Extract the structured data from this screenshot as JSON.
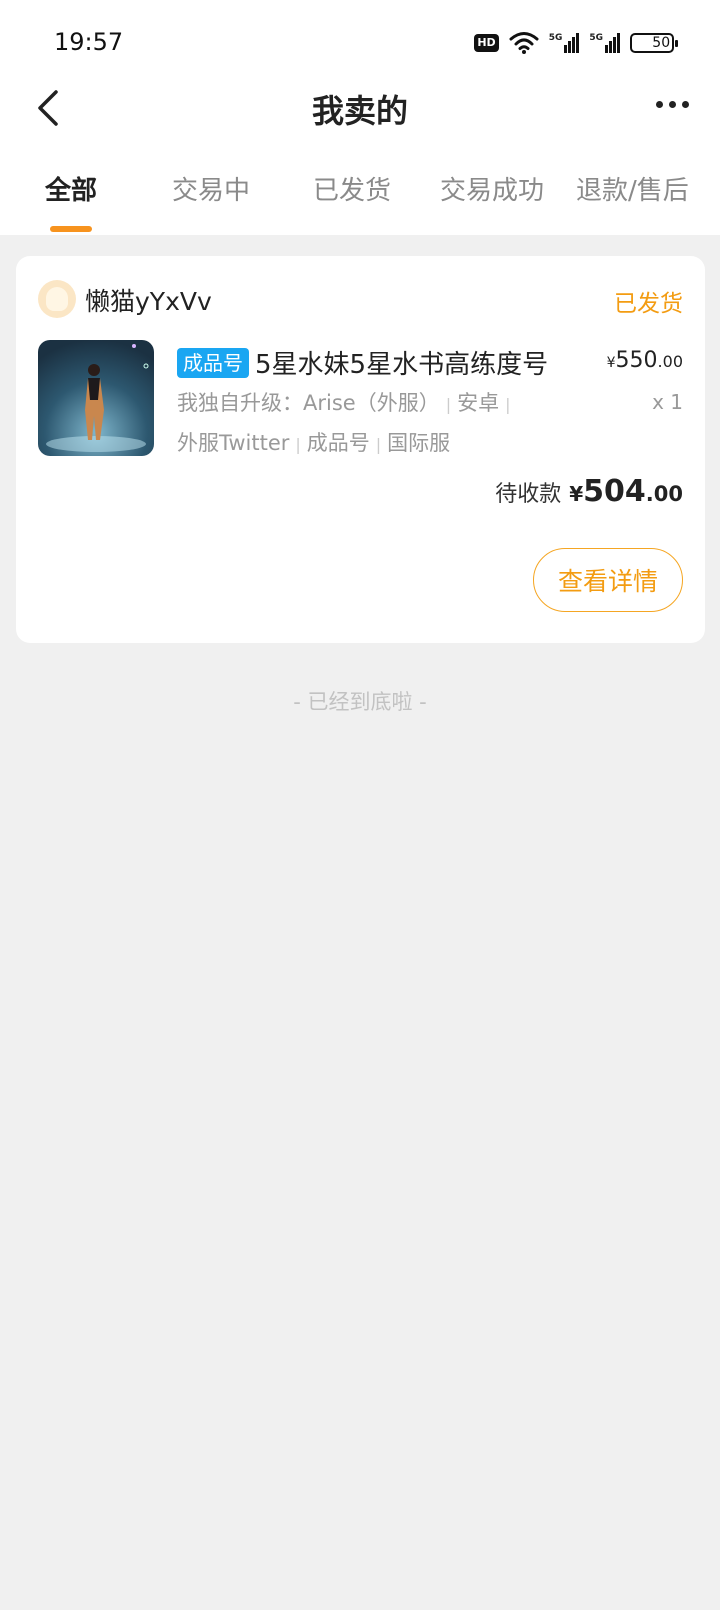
{
  "status_bar": {
    "time": "19:57",
    "hd_label": "HD",
    "network_label": "5G",
    "battery_level": "50"
  },
  "nav": {
    "title": "我卖的",
    "back_icon": "chevron-left-icon",
    "more_icon": "more-horizontal-icon"
  },
  "tabs": [
    {
      "label": "全部",
      "active": true
    },
    {
      "label": "交易中",
      "active": false
    },
    {
      "label": "已发货",
      "active": false
    },
    {
      "label": "交易成功",
      "active": false
    },
    {
      "label": "退款/售后",
      "active": false
    }
  ],
  "order": {
    "seller_name": "懒猫yYxVv",
    "status": "已发货",
    "tag": "成品号",
    "title": "5星水妹5星水书高练度号",
    "price_currency": "¥",
    "price_int": "550",
    "price_dec": ".00",
    "quantity": "x 1",
    "attrs": {
      "a1": "我独自升级：Arise（外服）",
      "a2": "安卓",
      "a3": "外服Twitter",
      "a4": "成品号",
      "a5": "国际服"
    },
    "pending_label": "待收款",
    "pending_currency": "¥",
    "pending_int": "504",
    "pending_dec": ".00",
    "detail_button": "查看详情"
  },
  "footer_text": "- 已经到底啦 -",
  "colors": {
    "accent": "#f39c12",
    "tag_blue": "#1aa6f2",
    "background": "#f0f0f0"
  }
}
